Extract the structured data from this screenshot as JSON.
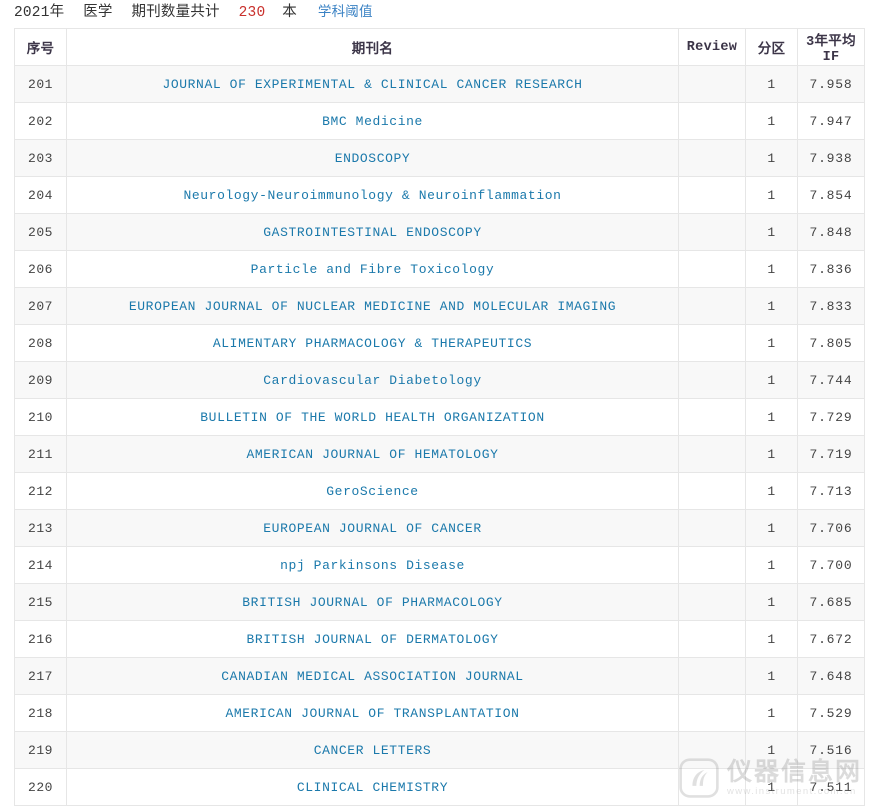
{
  "header": {
    "year": "2021年",
    "subject": "医学",
    "count_label": "期刊数量共计",
    "count": "230",
    "unit": "本",
    "threshold_link": "学科阈值",
    "accent_count_color": "#c9302c",
    "link_color": "#3a82c4"
  },
  "table": {
    "columns": [
      {
        "key": "seq",
        "label": "序号"
      },
      {
        "key": "name",
        "label": "期刊名"
      },
      {
        "key": "review",
        "label": "Review"
      },
      {
        "key": "zone",
        "label": "分区"
      },
      {
        "key": "if3",
        "label": "3年平均IF"
      }
    ],
    "journal_name_color": "#1b79ab",
    "rows": [
      {
        "seq": "201",
        "name": "JOURNAL OF EXPERIMENTAL & CLINICAL CANCER RESEARCH",
        "review": "",
        "zone": "1",
        "if3": "7.958"
      },
      {
        "seq": "202",
        "name": "BMC Medicine",
        "review": "",
        "zone": "1",
        "if3": "7.947"
      },
      {
        "seq": "203",
        "name": "ENDOSCOPY",
        "review": "",
        "zone": "1",
        "if3": "7.938"
      },
      {
        "seq": "204",
        "name": "Neurology-Neuroimmunology & Neuroinflammation",
        "review": "",
        "zone": "1",
        "if3": "7.854"
      },
      {
        "seq": "205",
        "name": "GASTROINTESTINAL ENDOSCOPY",
        "review": "",
        "zone": "1",
        "if3": "7.848"
      },
      {
        "seq": "206",
        "name": "Particle and Fibre Toxicology",
        "review": "",
        "zone": "1",
        "if3": "7.836"
      },
      {
        "seq": "207",
        "name": "EUROPEAN JOURNAL OF NUCLEAR MEDICINE AND MOLECULAR IMAGING",
        "review": "",
        "zone": "1",
        "if3": "7.833"
      },
      {
        "seq": "208",
        "name": "ALIMENTARY PHARMACOLOGY & THERAPEUTICS",
        "review": "",
        "zone": "1",
        "if3": "7.805"
      },
      {
        "seq": "209",
        "name": "Cardiovascular Diabetology",
        "review": "",
        "zone": "1",
        "if3": "7.744"
      },
      {
        "seq": "210",
        "name": "BULLETIN OF THE WORLD HEALTH ORGANIZATION",
        "review": "",
        "zone": "1",
        "if3": "7.729"
      },
      {
        "seq": "211",
        "name": "AMERICAN JOURNAL OF HEMATOLOGY",
        "review": "",
        "zone": "1",
        "if3": "7.719"
      },
      {
        "seq": "212",
        "name": "GeroScience",
        "review": "",
        "zone": "1",
        "if3": "7.713"
      },
      {
        "seq": "213",
        "name": "EUROPEAN JOURNAL OF CANCER",
        "review": "",
        "zone": "1",
        "if3": "7.706"
      },
      {
        "seq": "214",
        "name": "npj Parkinsons Disease",
        "review": "",
        "zone": "1",
        "if3": "7.700"
      },
      {
        "seq": "215",
        "name": "BRITISH JOURNAL OF PHARMACOLOGY",
        "review": "",
        "zone": "1",
        "if3": "7.685"
      },
      {
        "seq": "216",
        "name": "BRITISH JOURNAL OF DERMATOLOGY",
        "review": "",
        "zone": "1",
        "if3": "7.672"
      },
      {
        "seq": "217",
        "name": "CANADIAN MEDICAL ASSOCIATION JOURNAL",
        "review": "",
        "zone": "1",
        "if3": "7.648"
      },
      {
        "seq": "218",
        "name": "AMERICAN JOURNAL OF TRANSPLANTATION",
        "review": "",
        "zone": "1",
        "if3": "7.529"
      },
      {
        "seq": "219",
        "name": "CANCER LETTERS",
        "review": "",
        "zone": "1",
        "if3": "7.516"
      },
      {
        "seq": "220",
        "name": "CLINICAL CHEMISTRY",
        "review": "",
        "zone": "1",
        "if3": "7.511"
      }
    ]
  },
  "watermark": {
    "main": "仪器信息网",
    "sub": "www.instrument.com.cn"
  }
}
